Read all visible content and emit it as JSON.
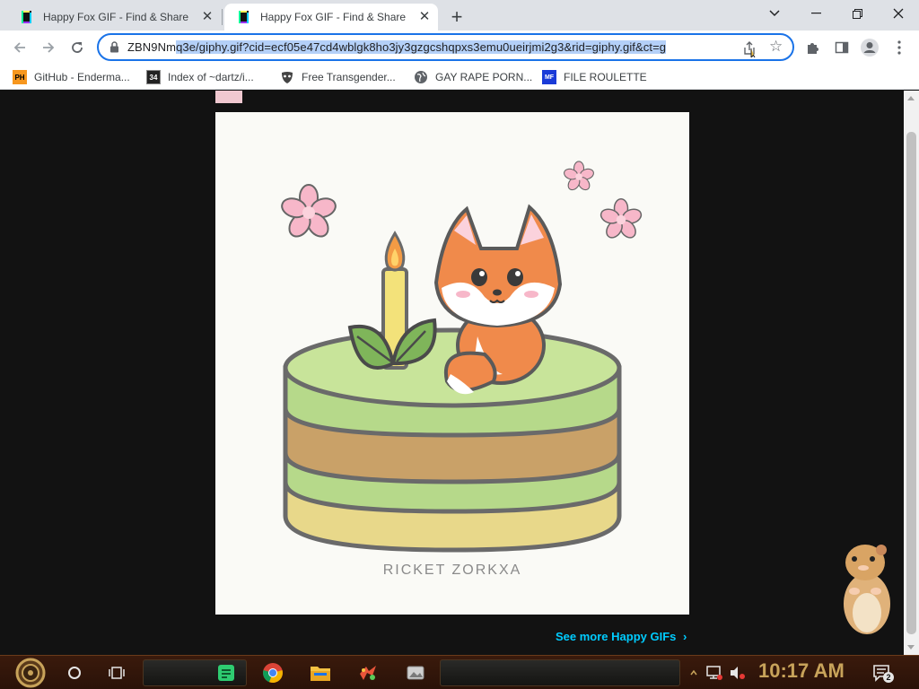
{
  "browser": {
    "tabs": [
      {
        "title": "Happy Fox GIF - Find & Share",
        "active": false
      },
      {
        "title": "Happy Fox GIF - Find & Share",
        "active": true
      }
    ],
    "new_tab_label": "+",
    "url_prefix": "ZBN9Nm",
    "url_selected": "q3e/giphy.gif?cid=ecf05e47cd4wblgk8ho3jy3gzgcshqpxs3emu0ueirjmi2g3&rid=giphy.gif&ct=g",
    "bookmarks": [
      {
        "label": "GitHub - Enderma...",
        "icon": "PH"
      },
      {
        "label": "Index of ~dartz/i...",
        "icon": "34"
      },
      {
        "label": "Free Transgender...",
        "icon": "mask-icon"
      },
      {
        "label": "GAY RAPE PORN...",
        "icon": "globe-icon"
      },
      {
        "label": "FILE ROULETTE",
        "icon": "MF"
      }
    ]
  },
  "page": {
    "gif_watermark": "RICKET ZORKXA",
    "see_more": "See more Happy GIFs"
  },
  "taskbar": {
    "clock": "10:17 AM",
    "notification_count": "2"
  },
  "colors": {
    "accent_blue": "#1a73e8",
    "link_cyan": "#00ccff",
    "clock_gold": "#c8a35a",
    "cake_green": "#b6d98a",
    "cake_brown": "#c9a168",
    "cake_yellow": "#e8d88a",
    "fox_orange": "#f08a4b"
  }
}
